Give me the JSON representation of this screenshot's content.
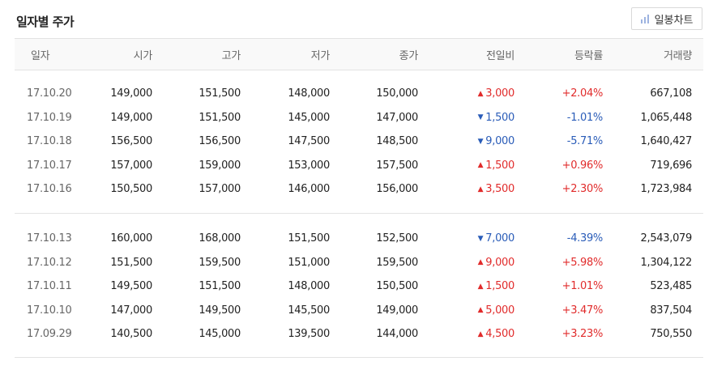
{
  "title": "일자별 주가",
  "chart_button": {
    "label": "일봉차트",
    "icon": "bar-chart-icon"
  },
  "columns": [
    "일자",
    "시가",
    "고가",
    "저가",
    "종가",
    "전일비",
    "등락률",
    "거래량"
  ],
  "colors": {
    "up": "#e12b2b",
    "down": "#2a5cb8"
  },
  "groups": [
    [
      {
        "date": "17.10.20",
        "open": "149,000",
        "high": "151,500",
        "low": "148,000",
        "close": "150,000",
        "dir": "up",
        "change": "3,000",
        "rate": "+2.04%",
        "volume": "667,108"
      },
      {
        "date": "17.10.19",
        "open": "149,000",
        "high": "151,500",
        "low": "145,000",
        "close": "147,000",
        "dir": "down",
        "change": "1,500",
        "rate": "-1.01%",
        "volume": "1,065,448"
      },
      {
        "date": "17.10.18",
        "open": "156,500",
        "high": "156,500",
        "low": "147,500",
        "close": "148,500",
        "dir": "down",
        "change": "9,000",
        "rate": "-5.71%",
        "volume": "1,640,427"
      },
      {
        "date": "17.10.17",
        "open": "157,000",
        "high": "159,000",
        "low": "153,000",
        "close": "157,500",
        "dir": "up",
        "change": "1,500",
        "rate": "+0.96%",
        "volume": "719,696"
      },
      {
        "date": "17.10.16",
        "open": "150,500",
        "high": "157,000",
        "low": "146,000",
        "close": "156,000",
        "dir": "up",
        "change": "3,500",
        "rate": "+2.30%",
        "volume": "1,723,984"
      }
    ],
    [
      {
        "date": "17.10.13",
        "open": "160,000",
        "high": "168,000",
        "low": "151,500",
        "close": "152,500",
        "dir": "down",
        "change": "7,000",
        "rate": "-4.39%",
        "volume": "2,543,079"
      },
      {
        "date": "17.10.12",
        "open": "151,500",
        "high": "159,500",
        "low": "151,000",
        "close": "159,500",
        "dir": "up",
        "change": "9,000",
        "rate": "+5.98%",
        "volume": "1,304,122"
      },
      {
        "date": "17.10.11",
        "open": "149,500",
        "high": "151,500",
        "low": "148,000",
        "close": "150,500",
        "dir": "up",
        "change": "1,500",
        "rate": "+1.01%",
        "volume": "523,485"
      },
      {
        "date": "17.10.10",
        "open": "147,000",
        "high": "149,500",
        "low": "145,500",
        "close": "149,000",
        "dir": "up",
        "change": "5,000",
        "rate": "+3.47%",
        "volume": "837,504"
      },
      {
        "date": "17.09.29",
        "open": "140,500",
        "high": "145,000",
        "low": "139,500",
        "close": "144,000",
        "dir": "up",
        "change": "4,500",
        "rate": "+3.23%",
        "volume": "750,550"
      }
    ]
  ]
}
